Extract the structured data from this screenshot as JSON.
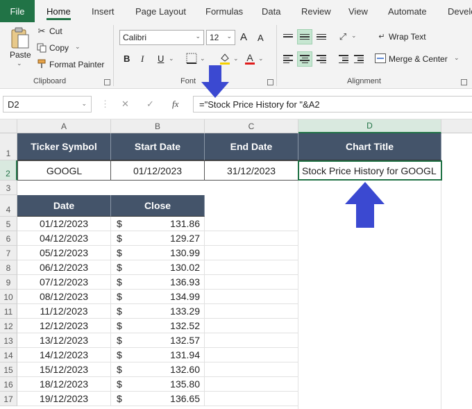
{
  "menu": {
    "tabs": [
      "File",
      "Home",
      "Insert",
      "Page Layout",
      "Formulas",
      "Data",
      "Review",
      "View",
      "Automate",
      "Develo"
    ]
  },
  "ribbon": {
    "clipboard": {
      "paste": "Paste",
      "cut": "Cut",
      "copy": "Copy",
      "format_painter": "Format Painter",
      "label": "Clipboard"
    },
    "font": {
      "family": "Calibri",
      "size": "12",
      "label": "Font",
      "bold": "B",
      "italic": "I",
      "underline": "U",
      "grow": "A",
      "shrink": "A"
    },
    "alignment": {
      "wrap_text": "Wrap Text",
      "merge_center": "Merge & Center",
      "label": "Alignment"
    }
  },
  "formula_bar": {
    "name_box": "D2",
    "fx": "fx",
    "formula": "=\"Stock Price History for \"&A2"
  },
  "columns": [
    "A",
    "B",
    "C",
    "D"
  ],
  "rows": [
    "1",
    "2",
    "3",
    "4",
    "5",
    "6",
    "7",
    "8",
    "9",
    "10",
    "11",
    "12",
    "13",
    "14",
    "15",
    "16",
    "17"
  ],
  "summary": {
    "headers": [
      "Ticker Symbol",
      "Start Date",
      "End Date",
      "Chart Title"
    ],
    "values": [
      "GOOGL",
      "01/12/2023",
      "31/12/2023",
      "Stock Price History for GOOGL"
    ]
  },
  "prices": {
    "headers": [
      "Date",
      "Close"
    ],
    "currency": "$",
    "rows": [
      [
        "01/12/2023",
        "131.86"
      ],
      [
        "04/12/2023",
        "129.27"
      ],
      [
        "05/12/2023",
        "130.99"
      ],
      [
        "06/12/2023",
        "130.02"
      ],
      [
        "07/12/2023",
        "136.93"
      ],
      [
        "08/12/2023",
        "134.99"
      ],
      [
        "11/12/2023",
        "133.29"
      ],
      [
        "12/12/2023",
        "132.52"
      ],
      [
        "13/12/2023",
        "132.57"
      ],
      [
        "14/12/2023",
        "131.94"
      ],
      [
        "15/12/2023",
        "132.60"
      ],
      [
        "18/12/2023",
        "135.80"
      ],
      [
        "19/12/2023",
        "136.65"
      ]
    ]
  },
  "colors": {
    "excel_green": "#217346",
    "header_fill": "#44546a",
    "arrow_blue": "#3b49d1"
  }
}
